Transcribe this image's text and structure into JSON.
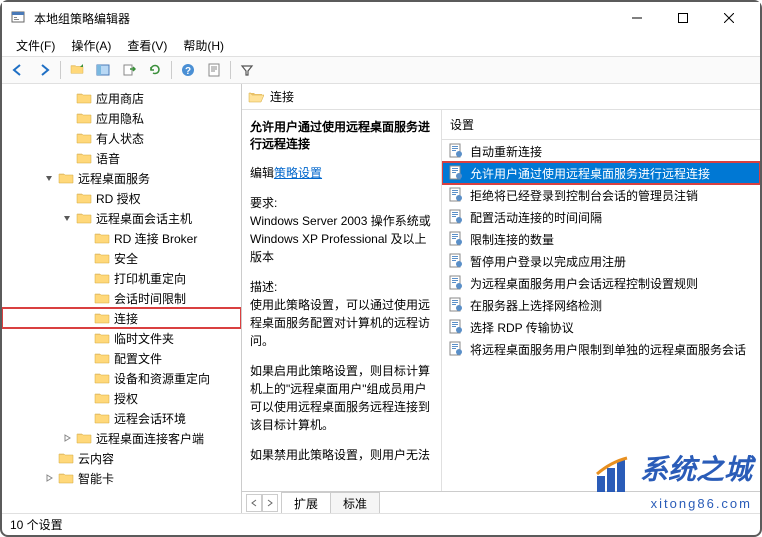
{
  "window": {
    "title": "本地组策略编辑器"
  },
  "menu": {
    "file": "文件(F)",
    "action": "操作(A)",
    "view": "查看(V)",
    "help": "帮助(H)"
  },
  "tree": {
    "items": [
      {
        "label": "应用商店",
        "indent": 3,
        "expander": ""
      },
      {
        "label": "应用隐私",
        "indent": 3,
        "expander": ""
      },
      {
        "label": "有人状态",
        "indent": 3,
        "expander": ""
      },
      {
        "label": "语音",
        "indent": 3,
        "expander": ""
      },
      {
        "label": "远程桌面服务",
        "indent": 2,
        "expander": "open"
      },
      {
        "label": "RD 授权",
        "indent": 3,
        "expander": ""
      },
      {
        "label": "远程桌面会话主机",
        "indent": 3,
        "expander": "open"
      },
      {
        "label": "RD 连接 Broker",
        "indent": 4,
        "expander": ""
      },
      {
        "label": "安全",
        "indent": 4,
        "expander": ""
      },
      {
        "label": "打印机重定向",
        "indent": 4,
        "expander": ""
      },
      {
        "label": "会话时间限制",
        "indent": 4,
        "expander": ""
      },
      {
        "label": "连接",
        "indent": 4,
        "expander": "",
        "highlighted": true,
        "selected": false
      },
      {
        "label": "临时文件夹",
        "indent": 4,
        "expander": ""
      },
      {
        "label": "配置文件",
        "indent": 4,
        "expander": ""
      },
      {
        "label": "设备和资源重定向",
        "indent": 4,
        "expander": ""
      },
      {
        "label": "授权",
        "indent": 4,
        "expander": ""
      },
      {
        "label": "远程会话环境",
        "indent": 4,
        "expander": ""
      },
      {
        "label": "远程桌面连接客户端",
        "indent": 3,
        "expander": "closed"
      },
      {
        "label": "云内容",
        "indent": 2,
        "expander": ""
      },
      {
        "label": "智能卡",
        "indent": 2,
        "expander": "closed"
      }
    ]
  },
  "detail": {
    "headerLabel": "连接",
    "title": "允许用户通过使用远程桌面服务进行远程连接",
    "editPrefix": "编辑",
    "editLink": "策略设置",
    "reqLabel": "要求:",
    "reqText": "Windows Server 2003 操作系统或 Windows XP Professional 及以上版本",
    "descLabel": "描述:",
    "descText1": "使用此策略设置，可以通过使用远程桌面服务配置对计算机的远程访问。",
    "descText2": "如果启用此策略设置，则目标计算机上的\"远程桌面用户\"组成员用户可以使用远程桌面服务远程连接到该目标计算机。",
    "descText3": "如果禁用此策略设置，则用户无法"
  },
  "settings": {
    "header": "设置",
    "items": [
      {
        "label": "自动重新连接"
      },
      {
        "label": "允许用户通过使用远程桌面服务进行远程连接",
        "selected": true,
        "redbox": true
      },
      {
        "label": "拒绝将已经登录到控制台会话的管理员注销"
      },
      {
        "label": "配置活动连接的时间间隔"
      },
      {
        "label": "限制连接的数量"
      },
      {
        "label": "暂停用户登录以完成应用注册"
      },
      {
        "label": "为远程桌面服务用户会话远程控制设置规则"
      },
      {
        "label": "在服务器上选择网络检测"
      },
      {
        "label": "选择 RDP 传输协议"
      },
      {
        "label": "将远程桌面服务用户限制到单独的远程桌面服务会话"
      }
    ]
  },
  "tabs": {
    "extended": "扩展",
    "standard": "标准"
  },
  "statusbar": {
    "text": "10 个设置"
  },
  "watermark": {
    "main": "系统之城",
    "sub": "xitong86.com"
  }
}
